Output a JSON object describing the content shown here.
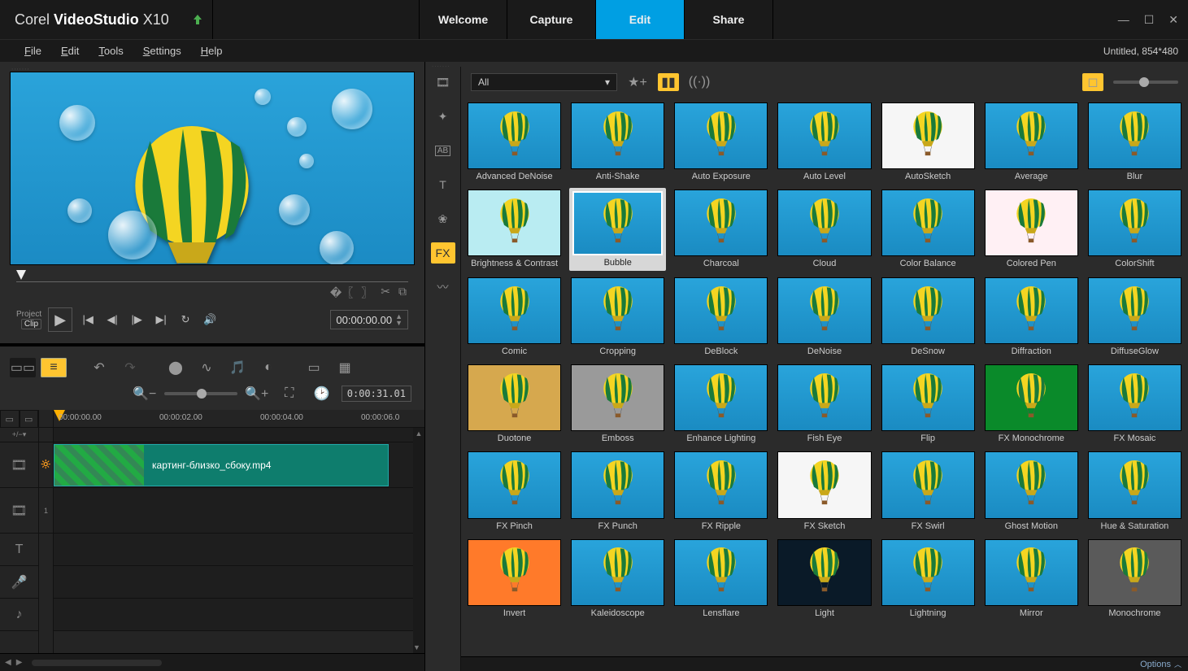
{
  "app": {
    "brand1": "Corel",
    "brand2": "VideoStudio",
    "brand3": "X10"
  },
  "modeTabs": [
    "Welcome",
    "Capture",
    "Edit",
    "Share"
  ],
  "activeModeIndex": 2,
  "menu": [
    "File",
    "Edit",
    "Tools",
    "Settings",
    "Help"
  ],
  "statusRight": "Untitled, 854*480",
  "transport": {
    "projectLabel": "Project",
    "clipLabel": "Clip",
    "timecode": "00:00:00.00"
  },
  "timeline": {
    "duration": "0:00:31.01",
    "ruler": [
      "00:00:00.00",
      "00:00:02.00",
      "00:00:04.00",
      "00:00:06.0"
    ],
    "clipName": "картинг-близко_сбоку.mp4"
  },
  "library": {
    "filterSelected": "All",
    "sideActive": "FX",
    "footer": "Options",
    "effects_row1": [
      "Advanced DeNoise",
      "Anti-Shake",
      "Auto Exposure",
      "Auto Level",
      "AutoSketch",
      "Average",
      "Blur"
    ],
    "effects_row2": [
      "Brightness & Contrast",
      "Bubble",
      "Charcoal",
      "Cloud",
      "Color Balance",
      "Colored Pen",
      "ColorShift"
    ],
    "effects_row3": [
      "Comic",
      "Cropping",
      "DeBlock",
      "DeNoise",
      "DeSnow",
      "Diffraction",
      "DiffuseGlow"
    ],
    "effects_row4": [
      "Duotone",
      "Emboss",
      "Enhance Lighting",
      "Fish Eye",
      "Flip",
      "FX Monochrome",
      "FX Mosaic"
    ],
    "effects_row5": [
      "FX Pinch",
      "FX Punch",
      "FX Ripple",
      "FX Sketch",
      "FX Swirl",
      "Ghost Motion",
      "Hue & Saturation"
    ],
    "effects_row6": [
      "Invert",
      "Kaleidoscope",
      "Lensflare",
      "Light",
      "Lightning",
      "Mirror",
      "Monochrome"
    ],
    "selected": "Bubble",
    "variants": {
      "AutoSketch": "bg-white",
      "Colored Pen": "bg-pink",
      "Emboss": "bg-gray",
      "Duotone": "bg-tan",
      "FX Monochrome": "bg-green",
      "FX Sketch": "bg-white",
      "Invert": "bg-orange",
      "Light": "bg-dark",
      "Monochrome": "bg-darkgray",
      "Brightness & Contrast": "bg-lightcyan",
      "Average": "",
      "Blur": ""
    }
  }
}
